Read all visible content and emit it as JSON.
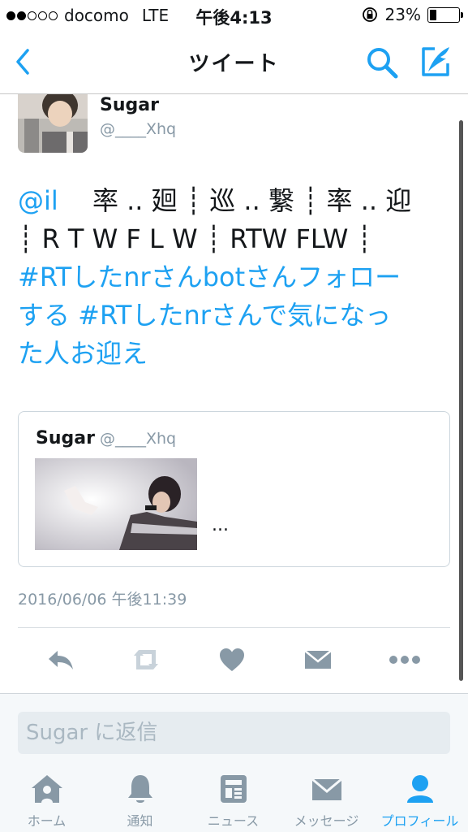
{
  "status_bar": {
    "carrier": "docomo",
    "network": "LTE",
    "time": "午後4:13",
    "battery_percent": "23%",
    "battery_level": 0.23
  },
  "nav": {
    "title": "ツイート",
    "back_icon": "chevron-left-icon",
    "search_icon": "search-icon",
    "compose_icon": "compose-icon"
  },
  "tweet": {
    "author_name": "Sugar",
    "author_handle": "@____Xhq",
    "text_lines": [
      "@il　 率 .. 廻 ┊ 巡 .. 繋 ┊ 率 .. 迎",
      "┊ R T W F L W ┊ RTW FLW ┊",
      "#RTしたnrさんbotさんフォロー",
      "する #RTしたnrさんで気になっ",
      "た人お迎え"
    ],
    "mention": "@il",
    "line1_rest": "　 率 .. 廻 ┊ 巡 .. 繋 ┊ 率 .. 迎",
    "line2": "┊ R T W F L W ┊ RTW FLW ┊",
    "line3": "#RTしたnrさんbotさんフォロー",
    "line4": "する #RTしたnrさんで気になっ",
    "line5": "た人お迎え",
    "timestamp": "2016/06/06 午後11:39"
  },
  "quoted_tweet": {
    "author_name": "Sugar",
    "author_handle": "@____Xhq",
    "text": "..."
  },
  "actions": [
    "reply-icon",
    "retweet-icon",
    "like-icon",
    "message-icon",
    "more-icon"
  ],
  "reply": {
    "placeholder": "Sugar に返信"
  },
  "tabs": [
    {
      "label": "ホーム",
      "icon": "home-icon"
    },
    {
      "label": "通知",
      "icon": "bell-icon"
    },
    {
      "label": "ニュース",
      "icon": "news-icon"
    },
    {
      "label": "メッセージ",
      "icon": "envelope-icon"
    },
    {
      "label": "プロフィール",
      "icon": "profile-icon",
      "active": true
    }
  ],
  "colors": {
    "accent": "#1da1f2",
    "icon_gray": "#8899a6",
    "text": "#14171a"
  }
}
